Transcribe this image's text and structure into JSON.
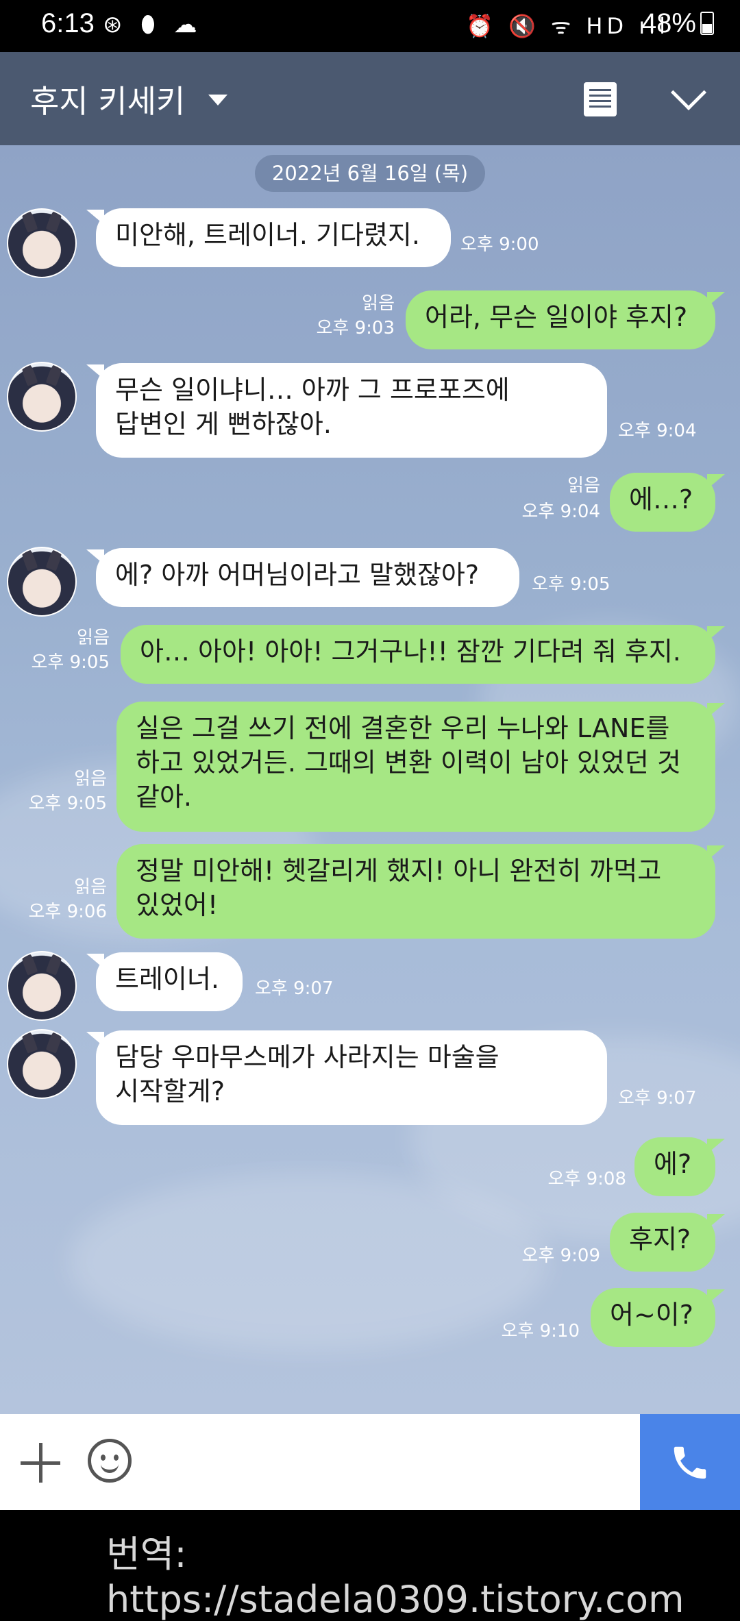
{
  "status_bar": {
    "time": "6:13",
    "left_icons": "⊛ ⬮ ☁",
    "right_icons": "⏰ 🔇 ᯤ HD ıll",
    "battery": "48%"
  },
  "header": {
    "title": "후지 키세키",
    "menu_icon": "document-list-icon",
    "collapse_icon": "chevron-down-icon"
  },
  "chat": {
    "date": "2022년 6월 16일 (목)",
    "messages": [
      {
        "side": "in",
        "text": "미안해, 트레이너. 기다렸지.",
        "time": "오후 9:00"
      },
      {
        "side": "out",
        "text": "어라, 무슨 일이야 후지?",
        "read": "읽음",
        "time": "오후 9:03"
      },
      {
        "side": "in",
        "lines": [
          "무슨 일이냐니… 아까 그 프로포즈에",
          "답변인 게 뻔하잖아."
        ],
        "time": "오후 9:04"
      },
      {
        "side": "out",
        "text": "에…?",
        "read": "읽음",
        "time": "오후 9:04"
      },
      {
        "side": "in",
        "text": "에? 아까 어머님이라고 말했잖아?",
        "time": "오후 9:05"
      },
      {
        "side": "out",
        "text": "아… 아아! 아아! 그거구나!! 잠깐 기다려 줘 후지.",
        "read": "읽음",
        "time": "오후 9:05"
      },
      {
        "side": "out",
        "lines": [
          "실은 그걸 쓰기 전에 결혼한 우리 누나와 LANE를",
          "하고 있었거든. 그때의 변환 이력이 남아 있었던 것",
          "같아."
        ],
        "read": "읽음",
        "time": "오후 9:05"
      },
      {
        "side": "out",
        "lines": [
          "정말 미안해! 헷갈리게 했지! 아니 완전히 까먹고",
          "있었어!"
        ],
        "read": "읽음",
        "time": "오후 9:06"
      },
      {
        "side": "in",
        "text": "트레이너.",
        "time": "오후 9:07"
      },
      {
        "side": "in",
        "lines": [
          "담당 우마무스메가 사라지는 마술을",
          "시작할게?"
        ],
        "time": "오후 9:07"
      },
      {
        "side": "out",
        "text": "에?",
        "time": "오후 9:08"
      },
      {
        "side": "out",
        "text": "후지?",
        "time": "오후 9:09"
      },
      {
        "side": "out",
        "text": "어~이?",
        "time": "오후 9:10"
      }
    ]
  },
  "input_bar": {
    "plus_icon": "plus-icon",
    "emoji_icon": "emoji-icon",
    "call_icon": "phone-icon"
  },
  "watermark": "번역: https://stadela0309.tistory.com",
  "colors": {
    "header_bg": "#4b5970",
    "bubble_out": "#a6e784",
    "bubble_in": "#ffffff",
    "call_button": "#4a84e8"
  }
}
